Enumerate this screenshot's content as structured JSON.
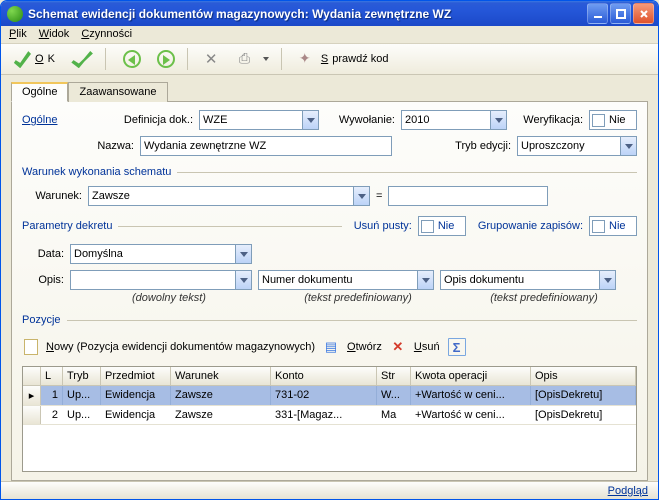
{
  "window": {
    "title": "Schemat ewidencji dokumentów magazynowych: Wydania zewnętrzne WZ"
  },
  "menu": {
    "plik": "Plik",
    "widok": "Widok",
    "czynnosci": "Czynności"
  },
  "toolbar": {
    "ok": "OK",
    "sprawdz": "Sprawdź kod"
  },
  "tabs": {
    "ogolne": "Ogólne",
    "zaawansowane": "Zaawansowane"
  },
  "form": {
    "ogolne_link": "Ogólne",
    "definicja_lbl": "Definicja dok.:",
    "definicja_val": "WZE",
    "wywolanie_lbl": "Wywołanie:",
    "wywolanie_val": "2010",
    "weryfikacja_lbl": "Weryfikacja:",
    "weryfikacja_val": "Nie",
    "nazwa_lbl": "Nazwa:",
    "nazwa_val": "Wydania zewnętrzne WZ",
    "tryb_lbl": "Tryb edycji:",
    "tryb_val": "Uproszczony",
    "sec_warunek": "Warunek wykonania schematu",
    "warunek_lbl": "Warunek:",
    "warunek_val": "Zawsze",
    "eq": "=",
    "sec_param": "Parametry dekretu",
    "usun_lbl": "Usuń pusty:",
    "usun_val": "Nie",
    "grup_lbl": "Grupowanie zapisów:",
    "grup_val": "Nie",
    "data_lbl": "Data:",
    "data_val": "Domyślna",
    "opis_lbl": "Opis:",
    "opis1_val": "",
    "opis2_val": "Numer dokumentu",
    "opis3_val": "Opis dokumentu",
    "hint_free": "(dowolny tekst)",
    "hint_pre": "(tekst predefiniowany)",
    "sec_pozycje": "Pozycje"
  },
  "gridtb": {
    "nowy": "Nowy",
    "nowy_hint": "(Pozycja ewidencji dokumentów magazynowych)",
    "otworz": "Otwórz",
    "usun": "Usuń"
  },
  "grid": {
    "headers": {
      "l": "L",
      "tryb": "Tryb",
      "przedmiot": "Przedmiot",
      "warunek": "Warunek",
      "konto": "Konto",
      "strona": "Str",
      "kwota": "Kwota operacji",
      "opis": "Opis"
    },
    "rows": [
      {
        "l": "1",
        "tryb": "Up...",
        "przedmiot": "Ewidencja",
        "warunek": "Zawsze",
        "konto": "731-02",
        "strona": "W...",
        "kwota": "+Wartość w ceni...",
        "opis": "[OpisDekretu]"
      },
      {
        "l": "2",
        "tryb": "Up...",
        "przedmiot": "Ewidencja",
        "warunek": "Zawsze",
        "konto": "331-[Magaz...",
        "strona": "Ma",
        "kwota": "+Wartość w ceni...",
        "opis": "[OpisDekretu]"
      }
    ]
  },
  "status": {
    "podglad": "Podgląd"
  }
}
